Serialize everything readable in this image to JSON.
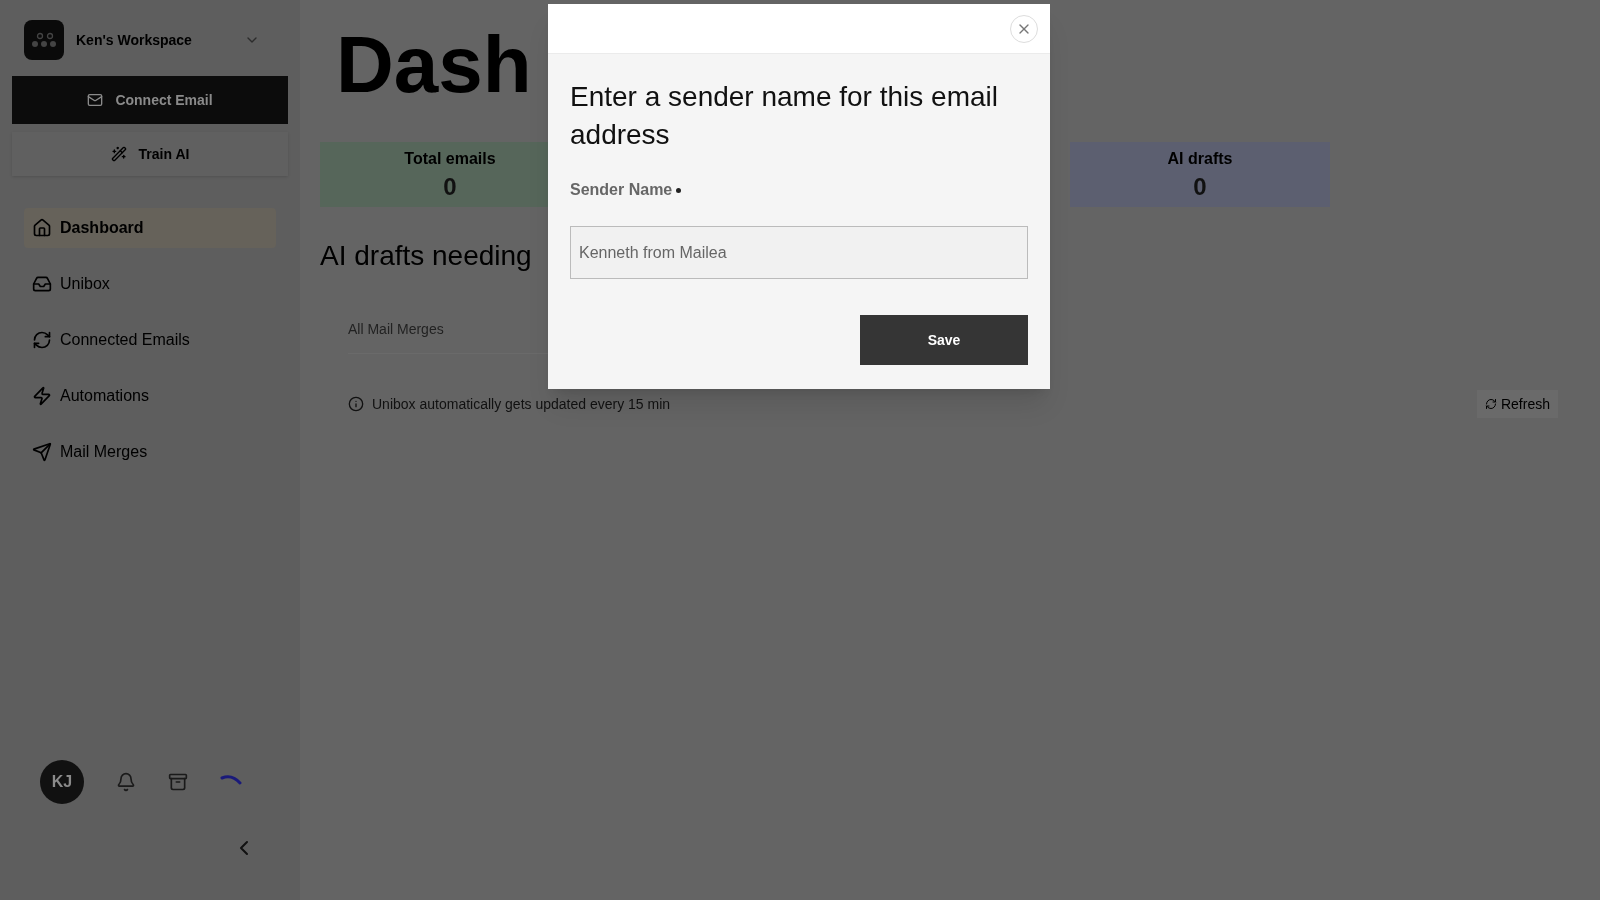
{
  "workspace": {
    "name": "Ken's Workspace"
  },
  "sidebar": {
    "buttons": [
      {
        "label": "Connect Email",
        "kind": "primary"
      },
      {
        "label": "Train AI",
        "kind": "secondary"
      }
    ],
    "items": [
      {
        "label": "Dashboard",
        "selected": true
      },
      {
        "label": "Unibox",
        "selected": false
      },
      {
        "label": "Connected Emails",
        "selected": false
      },
      {
        "label": "Automations",
        "selected": false
      },
      {
        "label": "Mail Merges",
        "selected": false
      }
    ],
    "avatar": "KJ"
  },
  "main": {
    "title": "Dash",
    "stats": [
      {
        "label": "Total emails",
        "value": "0",
        "color": "#56665a"
      },
      {
        "label": "AI drafts",
        "value": "0",
        "color": "#5c5f70"
      }
    ],
    "section_title": "AI drafts needing",
    "filter": "All Mail Merges",
    "info": "Unibox automatically gets updated every 15 min",
    "refresh": "Refresh"
  },
  "dialog": {
    "title": "Enter a sender name for this email address",
    "field_label": "Sender Name",
    "required": true,
    "value": "Kenneth from Mailea",
    "button": "Save"
  }
}
